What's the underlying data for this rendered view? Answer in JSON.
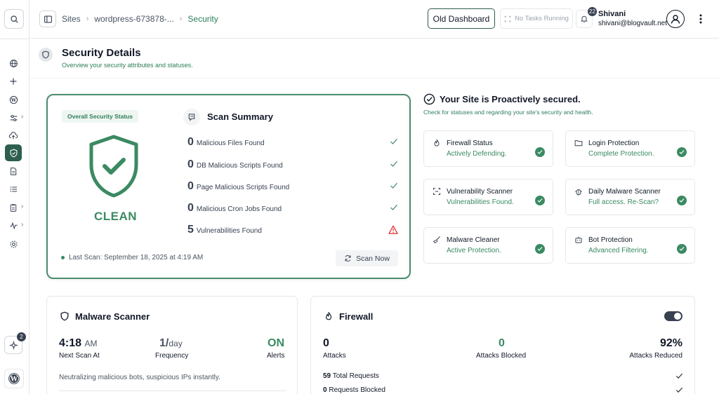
{
  "header": {
    "breadcrumbs": [
      "Sites",
      "wordpress-673878-...",
      "Security"
    ],
    "old_dashboard_label": "Old Dashboard",
    "tasks_label": "No Tasks Running",
    "notifications_count": "22",
    "user_name": "Shivani",
    "user_email": "shivani@blogvault.net"
  },
  "sidebar": {
    "ai_badge": "2",
    "items": [
      "globe-icon",
      "plus-icon",
      "wordpress-icon",
      "sliders-icon",
      "cloud-upload-icon",
      "shield-icon",
      "document-icon",
      "list-icon",
      "report-icon",
      "activity-icon",
      "settings-icon"
    ]
  },
  "page": {
    "title": "Security Details",
    "subtitle": "Overview your security attributes and statuses."
  },
  "status_card": {
    "pill": "Overall Security Status",
    "status": "CLEAN",
    "scan_title": "Scan Summary",
    "rows": [
      {
        "count": "0",
        "label": "Malicious Files Found",
        "state": "ok"
      },
      {
        "count": "0",
        "label": "DB Malicious Scripts Found",
        "state": "ok"
      },
      {
        "count": "0",
        "label": "Page Malicious Scripts Found",
        "state": "ok"
      },
      {
        "count": "0",
        "label": "Malicious Cron Jobs Found",
        "state": "ok"
      },
      {
        "count": "5",
        "label": "Vulnerabilities Found",
        "state": "warning"
      }
    ],
    "last_scan": "Last Scan: September 18, 2025 at 4:19 AM",
    "scan_now_label": "Scan Now"
  },
  "proactive": {
    "title": "Your Site is Proactively secured.",
    "subtitle": "Check for statuses and regarding your site's security and health.",
    "features": [
      {
        "title": "Firewall Status",
        "status": "Actively Defending.",
        "icon": "flame-icon"
      },
      {
        "title": "Login Protection",
        "status": "Complete Protection.",
        "icon": "folder-icon"
      },
      {
        "title": "Vulnerability Scanner",
        "status": "Vulnerabilities Found.",
        "icon": "scan-icon"
      },
      {
        "title": "Daily Malware Scanner",
        "status": "Full access. Re-Scan?",
        "icon": "bug-icon"
      },
      {
        "title": "Malware Cleaner",
        "status": "Active Protection.",
        "icon": "broom-icon"
      },
      {
        "title": "Bot Protection",
        "status": "Advanced Filtering.",
        "icon": "bot-icon"
      }
    ]
  },
  "malware_scanner": {
    "title": "Malware Scanner",
    "next_scan_time": "4:18",
    "next_scan_ampm": "AM",
    "next_scan_label": "Next Scan At",
    "frequency_value": "1/",
    "frequency_unit": "day",
    "frequency_label": "Frequency",
    "alerts_value": "ON",
    "alerts_label": "Alerts",
    "description": "Neutralizing malicious bots, suspicious IPs instantly."
  },
  "firewall": {
    "title": "Firewall",
    "toggle_on": true,
    "attacks_value": "0",
    "attacks_label": "Attacks",
    "blocked_value": "0",
    "blocked_label": "Attacks Blocked",
    "reduced_value": "92%",
    "reduced_label": "Attacks Reduced",
    "total_requests_value": "59",
    "total_requests_label": "Total Requests",
    "requests_blocked_value": "0",
    "requests_blocked_label": "Requests Blocked"
  },
  "colors": {
    "accent": "#2e7d5b",
    "card_border": "#4a8c6c",
    "sidebar_active": "#2e5e4e",
    "warning": "#dc2626"
  }
}
